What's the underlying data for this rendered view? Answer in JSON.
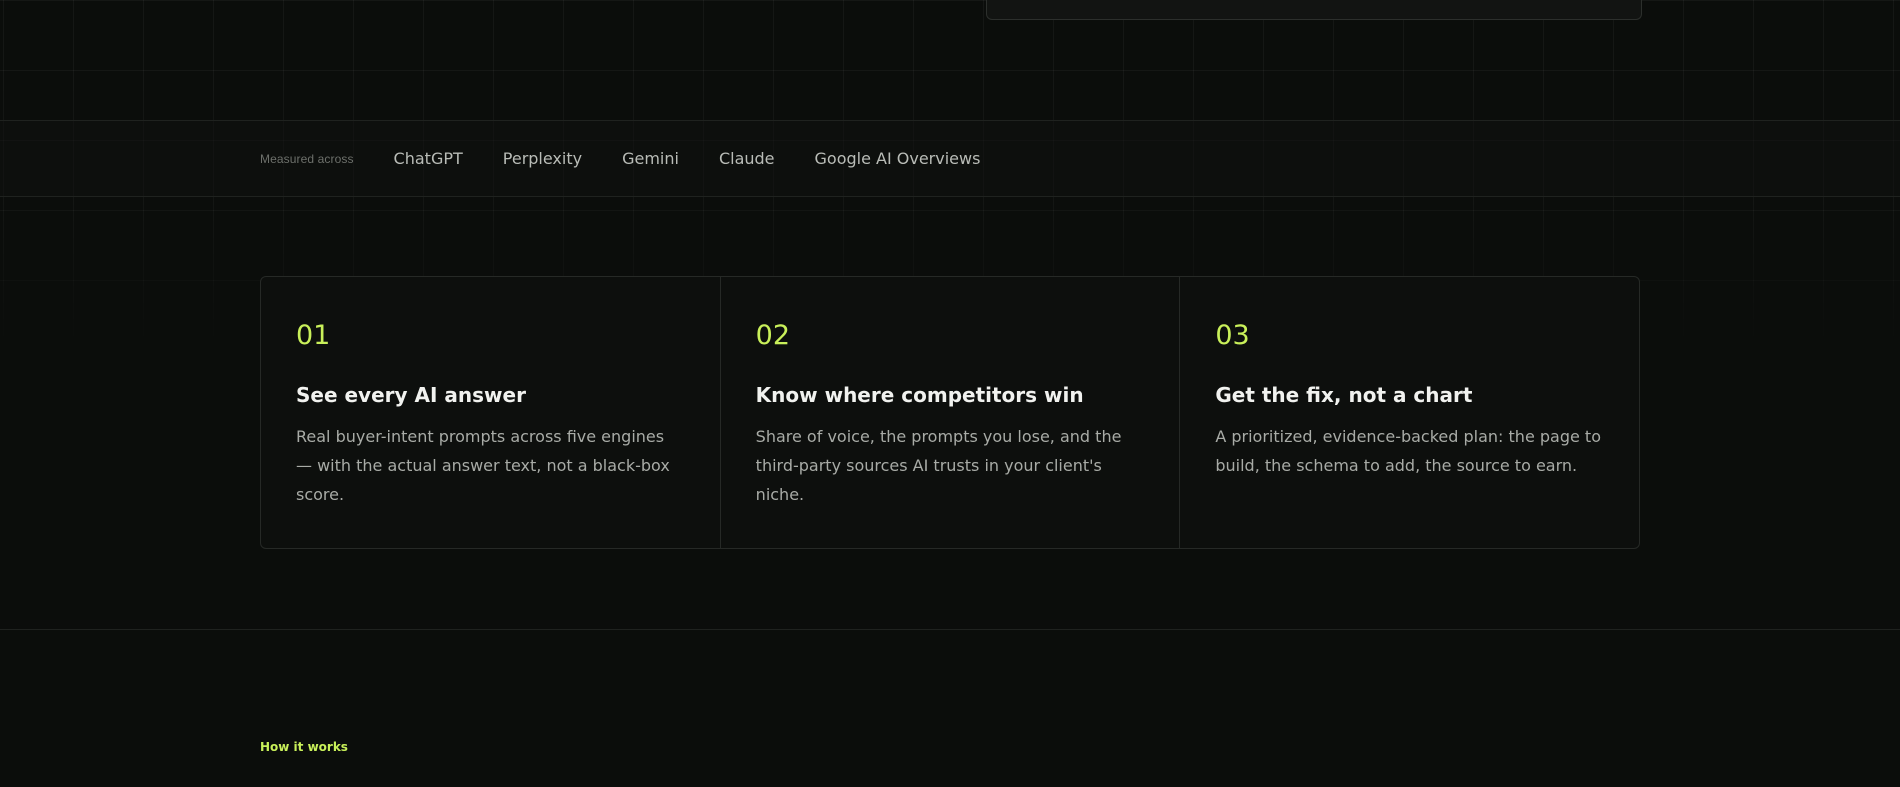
{
  "measured": {
    "label": "Measured across",
    "engines": [
      "ChatGPT",
      "Perplexity",
      "Gemini",
      "Claude",
      "Google AI Overviews"
    ]
  },
  "features": [
    {
      "number": "01",
      "title": "See every AI answer",
      "description": "Real buyer-intent prompts across five engines — with the actual answer text, not a black-box score."
    },
    {
      "number": "02",
      "title": "Know where competitors win",
      "description": "Share of voice, the prompts you lose, and the third-party sources AI trusts in your client's niche."
    },
    {
      "number": "03",
      "title": "Get the fix, not a chart",
      "description": "A prioritized, evidence-backed plan: the page to build, the schema to add, the source to earn."
    }
  ],
  "how_it_works": {
    "eyebrow": "How it works"
  },
  "colors": {
    "accent": "#c9f05a",
    "background": "#0b0d0b",
    "border": "#262926"
  }
}
